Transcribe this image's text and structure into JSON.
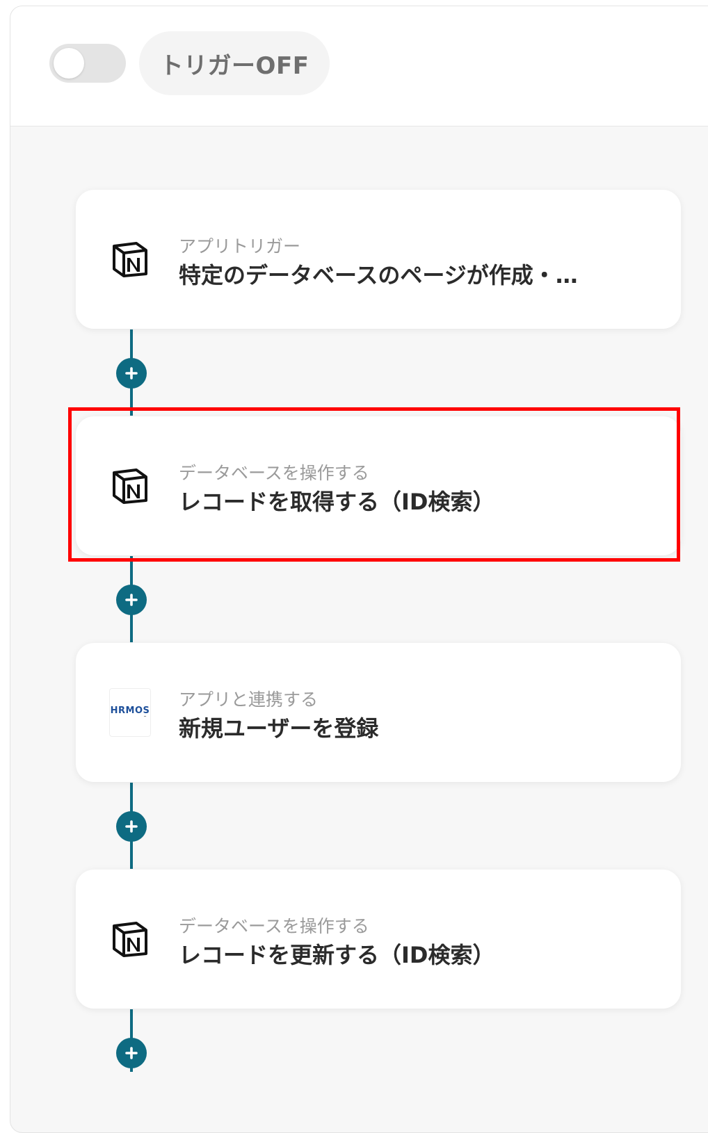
{
  "header": {
    "trigger_toggle_on": false,
    "trigger_status_label": "トリガーOFF"
  },
  "flow": {
    "accent_color": "#0e6b82",
    "steps": [
      {
        "icon": "notion-icon",
        "subtitle": "アプリトリガー",
        "title": "特定のデータベースのページが作成・…"
      },
      {
        "icon": "notion-icon",
        "subtitle": "データベースを操作する",
        "title": "レコードを取得する（ID検索）",
        "highlighted": true
      },
      {
        "icon": "hrmos-logo-icon",
        "logo_text": "HRMOS",
        "subtitle": "アプリと連携する",
        "title": "新規ユーザーを登録"
      },
      {
        "icon": "notion-icon",
        "subtitle": "データベースを操作する",
        "title": "レコードを更新する（ID検索）"
      }
    ]
  },
  "highlight_color": "#ff0000"
}
